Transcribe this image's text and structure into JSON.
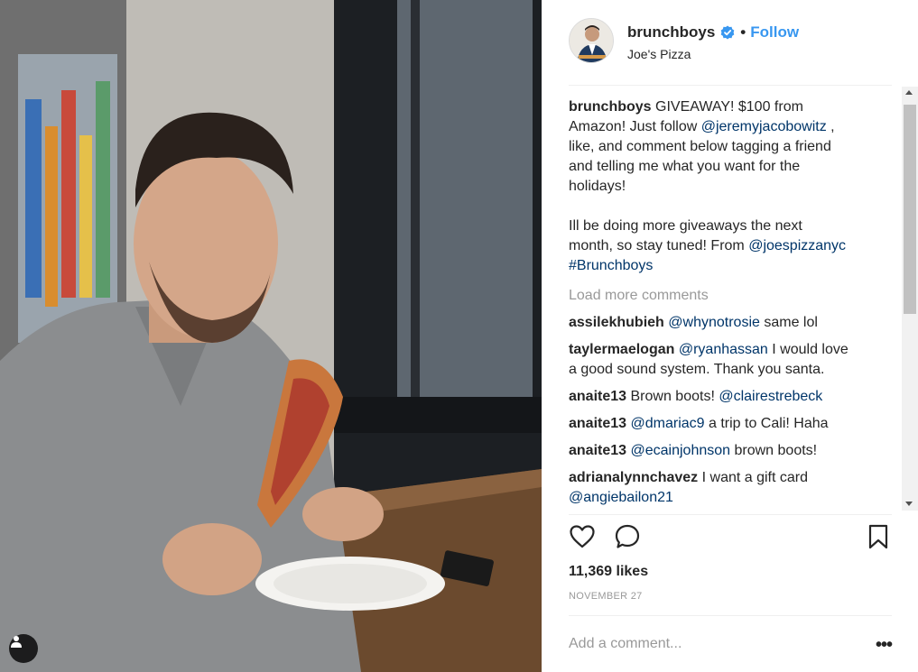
{
  "post": {
    "username": "brunchboys",
    "follow_label": "Follow",
    "separator": "•",
    "location": "Joe's Pizza",
    "caption": {
      "username": "brunchboys",
      "line1_text": "GIVEAWAY! $100 from",
      "line2_text": "Amazon! Just follow",
      "line2_mention": "@jeremyjacobowitz",
      "line2_tail": ",",
      "line3": "like, and comment below tagging a friend",
      "line4": "and telling me what you want for the",
      "line5": "holidays!",
      "line6": "Ill be doing more giveaways the next",
      "line7_text": "month, so stay tuned! From",
      "line7_mention": "@joespizzanyc",
      "line8_hashtag": "#Brunchboys"
    },
    "load_more_label": "Load more comments",
    "comments": [
      {
        "user": "assilekhubieh",
        "mention": "@whynotrosie",
        "text": "same lol"
      },
      {
        "user": "taylermaelogan",
        "mention": "@ryanhassan",
        "text": "I would love",
        "text2": "a good sound system. Thank you santa."
      },
      {
        "user": "anaite13",
        "text_pre": "Brown boots!",
        "mention": "@clairestrebeck"
      },
      {
        "user": "anaite13",
        "mention": "@dmariac9",
        "text": "a trip to Cali! Haha"
      },
      {
        "user": "anaite13",
        "mention": "@ecainjohnson",
        "text": "brown boots!"
      },
      {
        "user": "adrianalynnchavez",
        "text": "I want a gift card",
        "mention": "@angiebailon21"
      }
    ],
    "likes": "11,369 likes",
    "date": "NOVEMBER 27",
    "add_comment_placeholder": "Add a comment...",
    "more_label": "•••"
  },
  "icons": {
    "like": "heart-icon",
    "comment": "comment-bubble-icon",
    "save": "bookmark-icon",
    "verified": "verified-badge-icon",
    "user_tag": "user-tag-icon"
  },
  "colors": {
    "accent": "#3897f0",
    "link": "#003569",
    "muted": "#999999",
    "text": "#262626"
  }
}
